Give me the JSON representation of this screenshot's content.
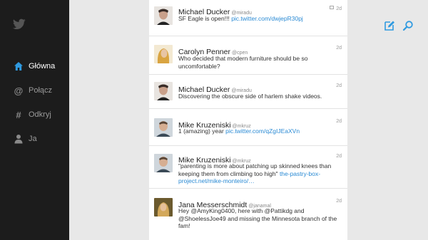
{
  "sidebar": {
    "logo_icon": "twitter-bird-icon",
    "items": [
      {
        "label": "Główna",
        "icon": "home-icon",
        "active": true
      },
      {
        "label": "Połącz",
        "icon": "at-sign-icon",
        "active": false
      },
      {
        "label": "Odkryj",
        "icon": "hashtag-icon",
        "active": false
      },
      {
        "label": "Ja",
        "icon": "person-icon",
        "active": false
      }
    ]
  },
  "actions": {
    "compose_icon": "compose-icon",
    "search_icon": "search-icon"
  },
  "colors": {
    "accent": "#2f9ae0",
    "link": "#2a8ad4",
    "sidebar_bg": "#1c1c1c",
    "background": "#e8e8e8"
  },
  "tweets": [
    {
      "name": "Michael Ducker",
      "handle": "@miradu",
      "time": "2d",
      "text_before": "SF Eagle is open!!! ",
      "link": "pic.twitter.com/dwjepR30pj",
      "text_after": "",
      "has_media": true
    },
    {
      "name": "Carolyn Penner",
      "handle": "@cpen",
      "time": "2d",
      "text_before": "Who decided that modern furniture should be so uncomfortable?",
      "link": "",
      "text_after": "",
      "has_media": false
    },
    {
      "name": "Michael Ducker",
      "handle": "@miradu",
      "time": "2d",
      "text_before": "Discovering the obscure side of harlem shake videos.",
      "link": "",
      "text_after": "",
      "has_media": false
    },
    {
      "name": "Mike Kruzeniski",
      "handle": "@mkruz",
      "time": "2d",
      "text_before": "1 (amazing) year ",
      "link": "pic.twitter.com/qZgIJEaXVn",
      "text_after": "",
      "has_media": false
    },
    {
      "name": "Mike Kruzeniski",
      "handle": "@mkruz",
      "time": "2d",
      "text_before": "\"parenting is more about patching up skinned knees than keeping them from climbing too high\" ",
      "link": "the-pastry-box-project.net/mike-monteiro/…",
      "text_after": "",
      "has_media": false
    },
    {
      "name": "Jana Messerschmidt",
      "handle": "@janamal",
      "time": "2d",
      "text_before": "Hey @AmyKing0400, here with @Pattikdg and @ShoelessJoe49 and missing the Minnesota branch of the fam!",
      "link": "",
      "text_after": "",
      "has_media": false
    }
  ]
}
